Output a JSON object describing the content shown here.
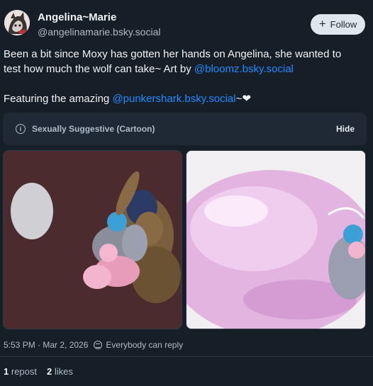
{
  "author": {
    "display_name": "Angelina~Marie",
    "handle": "@angelinamarie.bsky.social"
  },
  "follow_button": {
    "label": "Follow",
    "icon": "plus-icon"
  },
  "post": {
    "line1": "Been a bit since Moxy has gotten her hands on Angelina, she wanted to",
    "line2_text": "test how much the wolf can take~ Art by ",
    "line2_link": "@bloomz.bsky.social",
    "line3_text": "Featuring the amazing ",
    "line3_link": "@punkershark.bsky.social",
    "line3_suffix": "~❤"
  },
  "content_warning": {
    "icon": "info-icon",
    "label": "Sexually Suggestive (Cartoon)",
    "hide_label": "Hide"
  },
  "meta": {
    "timestamp": "5:53 PM · Mar 2, 2026",
    "reply_setting": "Everybody can reply",
    "reply_icon": "globe-icon"
  },
  "stats": {
    "reposts_count": "1",
    "reposts_label": "repost",
    "likes_count": "2",
    "likes_label": "likes"
  }
}
